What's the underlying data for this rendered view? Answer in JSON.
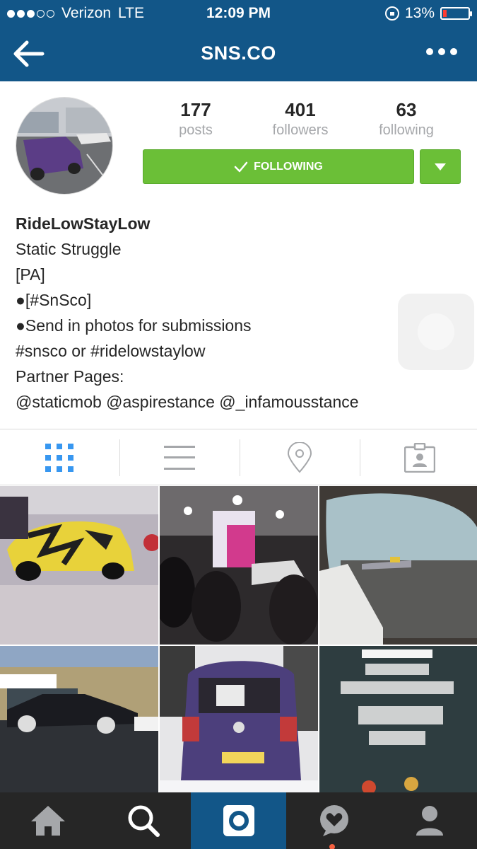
{
  "status_bar": {
    "carrier": "Verizon",
    "network": "LTE",
    "time": "12:09 PM",
    "battery": "13%",
    "signal_bars_filled": 3,
    "signal_bars_total": 5,
    "battery_level": 0.13
  },
  "navbar": {
    "title": "SNS.CO",
    "back_icon": "back-arrow-icon",
    "more_icon": "more-options-icon"
  },
  "profile": {
    "stats": [
      {
        "value": "177",
        "label": "posts"
      },
      {
        "value": "401",
        "label": "followers"
      },
      {
        "value": "63",
        "label": "following"
      }
    ],
    "follow_button_label": "FOLLOWING",
    "bio": {
      "name": "RideLowStayLow",
      "lines": [
        "Static Struggle",
        "[PA]",
        "●[#SnSco]",
        "●Send in photos for submissions",
        "#snsco or #ridelowstaylow",
        "Partner Pages:",
        "@staticmob @aspirestance @_infamousstance"
      ]
    }
  },
  "tabs": [
    "grid-view-icon",
    "list-view-icon",
    "location-pin-icon",
    "tagged-photos-icon"
  ],
  "bottom_nav": [
    "home-icon",
    "search-icon",
    "camera-icon",
    "activity-heart-icon",
    "profile-icon"
  ],
  "colors": {
    "brand_blue": "#125688",
    "follow_green": "#6bbf37",
    "tab_active": "#3897f0",
    "tab_inactive": "#a5a7aa"
  }
}
